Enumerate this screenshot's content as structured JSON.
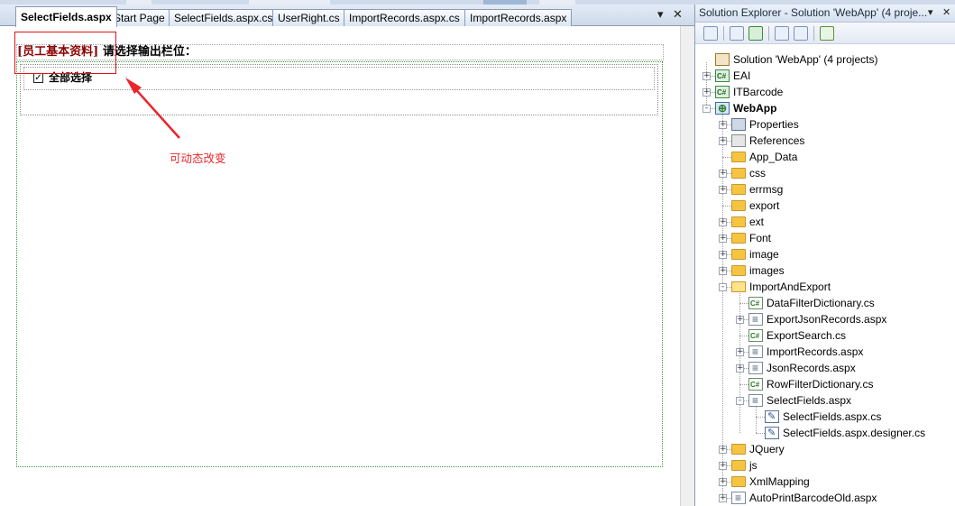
{
  "editor": {
    "tabs": [
      {
        "label": "SelectFields.aspx",
        "active": true
      },
      {
        "label": "Start Page",
        "active": false
      },
      {
        "label": "SelectFields.aspx.cs",
        "active": false
      },
      {
        "label": "UserRight.cs",
        "active": false
      },
      {
        "label": "ImportRecords.aspx.cs",
        "active": false
      },
      {
        "label": "ImportRecords.aspx",
        "active": false
      }
    ],
    "dropdown_glyph": "▾",
    "close_glyph": "✕"
  },
  "design": {
    "title_bracket_open": "[",
    "title_emph": "员工基本资料",
    "title_bracket_close": "]",
    "title_rest": " 请选择输出栏位：",
    "select_all_label": "全部选择",
    "checkbox_checked": true,
    "annotation": "可动态改变"
  },
  "explorer": {
    "title": "Solution Explorer - Solution 'WebApp' (4 proje...",
    "pin_glyph": "▾",
    "close_glyph": "✕",
    "toolbar_icons": [
      "properties-icon",
      "show-all-files-icon",
      "refresh-icon",
      "view-code-icon",
      "view-designer-icon",
      "class-diagram-icon"
    ],
    "nodes": [
      {
        "label": "Solution 'WebApp' (4 projects)",
        "icon": "solution-icon",
        "level": 0,
        "toggle": "",
        "bold": false
      },
      {
        "label": "EAI",
        "icon": "project-icon",
        "level": 0,
        "toggle": "+",
        "bold": false
      },
      {
        "label": "ITBarcode",
        "icon": "project-icon",
        "level": 0,
        "toggle": "+",
        "bold": false
      },
      {
        "label": "WebApp",
        "icon": "web-project-icon",
        "level": 0,
        "toggle": "-",
        "bold": true
      },
      {
        "label": "Properties",
        "icon": "properties-icon",
        "level": 1,
        "toggle": "+",
        "bold": false
      },
      {
        "label": "References",
        "icon": "references-icon",
        "level": 1,
        "toggle": "+",
        "bold": false
      },
      {
        "label": "App_Data",
        "icon": "folder-icon",
        "level": 1,
        "toggle": "",
        "bold": false
      },
      {
        "label": "css",
        "icon": "folder-icon",
        "level": 1,
        "toggle": "+",
        "bold": false
      },
      {
        "label": "errmsg",
        "icon": "folder-icon",
        "level": 1,
        "toggle": "+",
        "bold": false
      },
      {
        "label": "export",
        "icon": "folder-icon",
        "level": 1,
        "toggle": "",
        "bold": false
      },
      {
        "label": "ext",
        "icon": "folder-icon",
        "level": 1,
        "toggle": "+",
        "bold": false
      },
      {
        "label": "Font",
        "icon": "folder-icon",
        "level": 1,
        "toggle": "+",
        "bold": false
      },
      {
        "label": "image",
        "icon": "folder-icon",
        "level": 1,
        "toggle": "+",
        "bold": false
      },
      {
        "label": "images",
        "icon": "folder-icon",
        "level": 1,
        "toggle": "+",
        "bold": false
      },
      {
        "label": "ImportAndExport",
        "icon": "folder-open-icon",
        "level": 1,
        "toggle": "-",
        "bold": false
      },
      {
        "label": "DataFilterDictionary.cs",
        "icon": "cs-file-icon",
        "level": 2,
        "toggle": "",
        "bold": false
      },
      {
        "label": "ExportJsonRecords.aspx",
        "icon": "aspx-file-icon",
        "level": 2,
        "toggle": "+",
        "bold": false
      },
      {
        "label": "ExportSearch.cs",
        "icon": "cs-file-icon",
        "level": 2,
        "toggle": "",
        "bold": false
      },
      {
        "label": "ImportRecords.aspx",
        "icon": "aspx-file-icon",
        "level": 2,
        "toggle": "+",
        "bold": false
      },
      {
        "label": "JsonRecords.aspx",
        "icon": "aspx-file-icon",
        "level": 2,
        "toggle": "+",
        "bold": false
      },
      {
        "label": "RowFilterDictionary.cs",
        "icon": "cs-file-icon",
        "level": 2,
        "toggle": "",
        "bold": false
      },
      {
        "label": "SelectFields.aspx",
        "icon": "aspx-file-icon",
        "level": 2,
        "toggle": "-",
        "bold": false
      },
      {
        "label": "SelectFields.aspx.cs",
        "icon": "code-file-icon",
        "level": 3,
        "toggle": "",
        "bold": false
      },
      {
        "label": "SelectFields.aspx.designer.cs",
        "icon": "code-file-icon",
        "level": 3,
        "toggle": "",
        "bold": false
      },
      {
        "label": "JQuery",
        "icon": "folder-icon",
        "level": 1,
        "toggle": "+",
        "bold": false
      },
      {
        "label": "js",
        "icon": "folder-icon",
        "level": 1,
        "toggle": "+",
        "bold": false
      },
      {
        "label": "XmlMapping",
        "icon": "folder-icon",
        "level": 1,
        "toggle": "+",
        "bold": false
      },
      {
        "label": "AutoPrintBarcodeOld.aspx",
        "icon": "aspx-file-icon",
        "level": 1,
        "toggle": "+",
        "bold": false
      }
    ]
  },
  "colors": {
    "annotation_red": "#e8262b",
    "panel_border_green": "#3a9a3a",
    "title_emph": "#8b0000"
  }
}
